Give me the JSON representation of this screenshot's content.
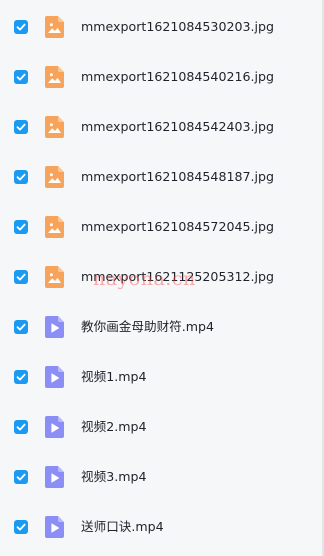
{
  "files": [
    {
      "name": "mmexport1621084530203.jpg",
      "type": "image",
      "checked": true,
      "icon": "image-file-icon"
    },
    {
      "name": "mmexport1621084540216.jpg",
      "type": "image",
      "checked": true,
      "icon": "image-file-icon"
    },
    {
      "name": "mmexport1621084542403.jpg",
      "type": "image",
      "checked": true,
      "icon": "image-file-icon"
    },
    {
      "name": "mmexport1621084548187.jpg",
      "type": "image",
      "checked": true,
      "icon": "image-file-icon"
    },
    {
      "name": "mmexport1621084572045.jpg",
      "type": "image",
      "checked": true,
      "icon": "image-file-icon"
    },
    {
      "name": "mmexport1621125205312.jpg",
      "type": "image",
      "checked": true,
      "icon": "image-file-icon"
    },
    {
      "name": "教你画金母助财符.mp4",
      "type": "video",
      "checked": true,
      "icon": "video-file-icon"
    },
    {
      "name": "视频1.mp4",
      "type": "video",
      "checked": true,
      "icon": "video-file-icon"
    },
    {
      "name": "视频2.mp4",
      "type": "video",
      "checked": true,
      "icon": "video-file-icon"
    },
    {
      "name": "视频3.mp4",
      "type": "video",
      "checked": true,
      "icon": "video-file-icon"
    },
    {
      "name": "送师口诀.mp4",
      "type": "video",
      "checked": true,
      "icon": "video-file-icon"
    }
  ],
  "watermark": "nayona.cn",
  "colors": {
    "checkbox": "#1a9af0",
    "image_icon": "#f7a35c",
    "video_icon": "#8b8ef5",
    "background": "#f6f7f9",
    "text": "#1f2329",
    "watermark": "#ff3d3d"
  }
}
